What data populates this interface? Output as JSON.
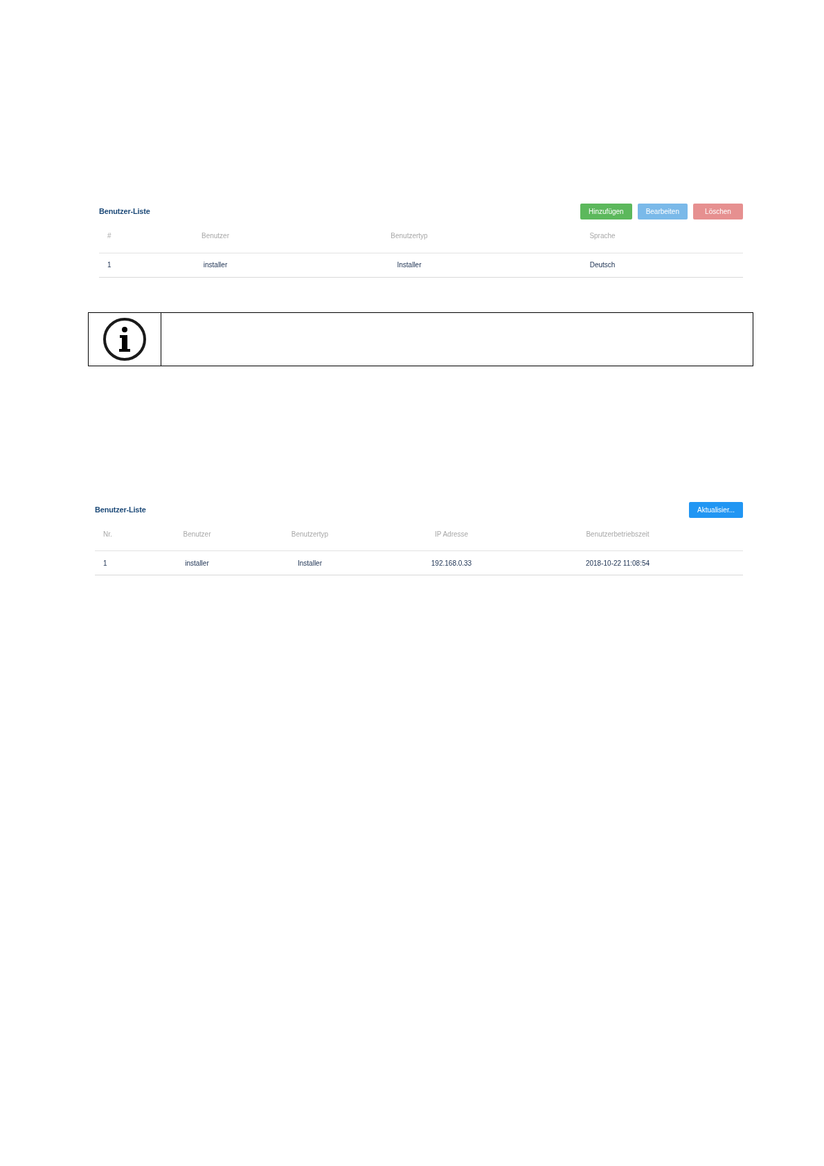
{
  "panels": [
    {
      "title": "Benutzer-Liste",
      "buttons": [
        {
          "label": "Hinzufügen",
          "color": "#5cb85c"
        },
        {
          "label": "Bearbeiten",
          "color": "#7ab9e9"
        },
        {
          "label": "Löschen",
          "color": "#e69090"
        }
      ],
      "table": {
        "columns": [
          "#",
          "Benutzer",
          "Benutzertyp",
          "Sprache"
        ],
        "rows": [
          [
            "1",
            "installer",
            "Installer",
            "Deutsch"
          ]
        ]
      }
    },
    {
      "title": "Benutzer-Liste",
      "buttons": [
        {
          "label": "Aktualisier...",
          "color": "#2196f3"
        }
      ],
      "table": {
        "columns": [
          "Nr.",
          "Benutzer",
          "Benutzertyp",
          "IP Adresse",
          "Benutzerbetriebszeit"
        ],
        "rows": [
          [
            "1",
            "installer",
            "Installer",
            "192.168.0.33",
            "2018-10-22 11:08:54"
          ]
        ]
      }
    }
  ],
  "info_box": {
    "kind": "info"
  }
}
